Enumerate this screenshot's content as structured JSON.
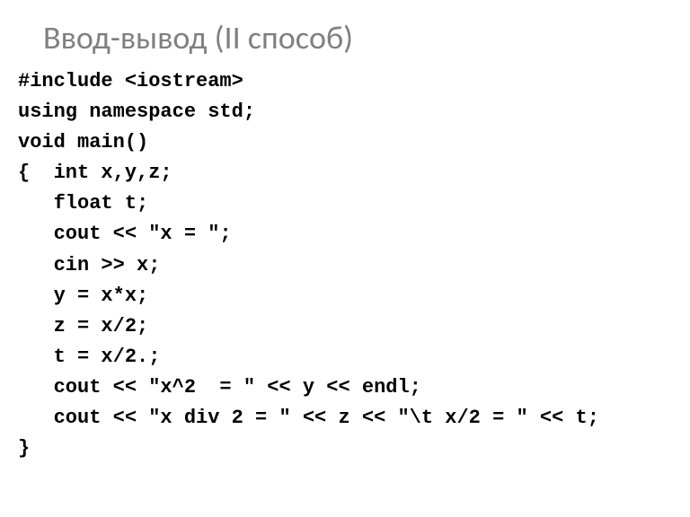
{
  "title": "Ввод-вывод (II способ)",
  "code": {
    "line1": "#include <iostream>",
    "line2": "using namespace std;",
    "line3": "void main()",
    "line4": "{  int x,y,z;",
    "line5": "   float t;",
    "line6": "   cout << \"x = \";",
    "line7": "   cin >> x;",
    "line8": "   y = x*x;",
    "line9": "   z = x/2;",
    "line10": "   t = x/2.;",
    "line11": "   cout << \"x^2  = \" << y << endl;",
    "line12": "   cout << \"x div 2 = \" << z << \"\\t x/2 = \" << t;",
    "line13": "}"
  }
}
